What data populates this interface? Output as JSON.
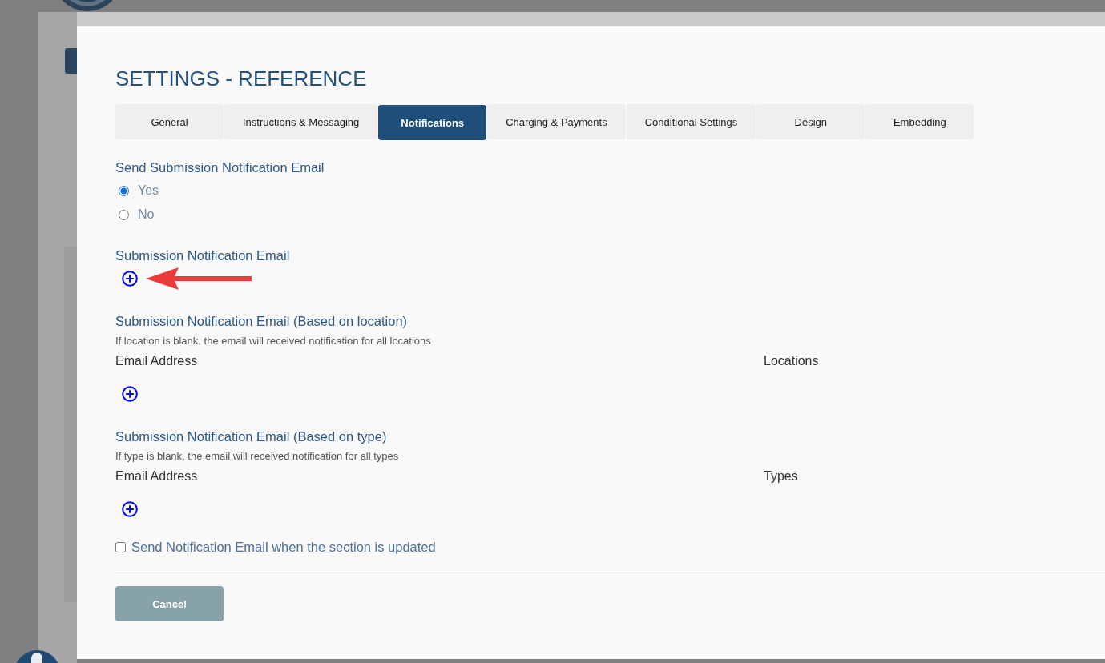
{
  "dialog": {
    "title": "SETTINGS - REFERENCE"
  },
  "tabs": [
    {
      "label": "General",
      "selected": false
    },
    {
      "label": "Instructions & Messaging",
      "selected": false
    },
    {
      "label": "Notifications",
      "selected": true
    },
    {
      "label": "Charging & Payments",
      "selected": false
    },
    {
      "label": "Conditional Settings",
      "selected": false
    },
    {
      "label": "Design",
      "selected": false
    },
    {
      "label": "Embedding",
      "selected": false
    }
  ],
  "send_submission_email": {
    "label": "Send Submission Notification Email",
    "options": [
      {
        "label": "Yes",
        "selected": true
      },
      {
        "label": "No",
        "selected": false
      }
    ]
  },
  "submission_email": {
    "label": "Submission Notification Email"
  },
  "email_sections": [
    {
      "title": "Submission Notification Email (Based on location)",
      "hint": "If location is blank, the email will received notification for all locations",
      "columns": [
        "Email Address",
        "Locations"
      ]
    },
    {
      "title": "Submission Notification Email (Based on type)",
      "hint": "If type is blank, the email will received notification for all types",
      "columns": [
        "Email Address",
        "Types"
      ]
    }
  ],
  "notify_on_update": {
    "label": "Send Notification Email when the section is updated",
    "checked": false
  },
  "buttons": [
    {
      "label": "Cancel"
    }
  ]
}
